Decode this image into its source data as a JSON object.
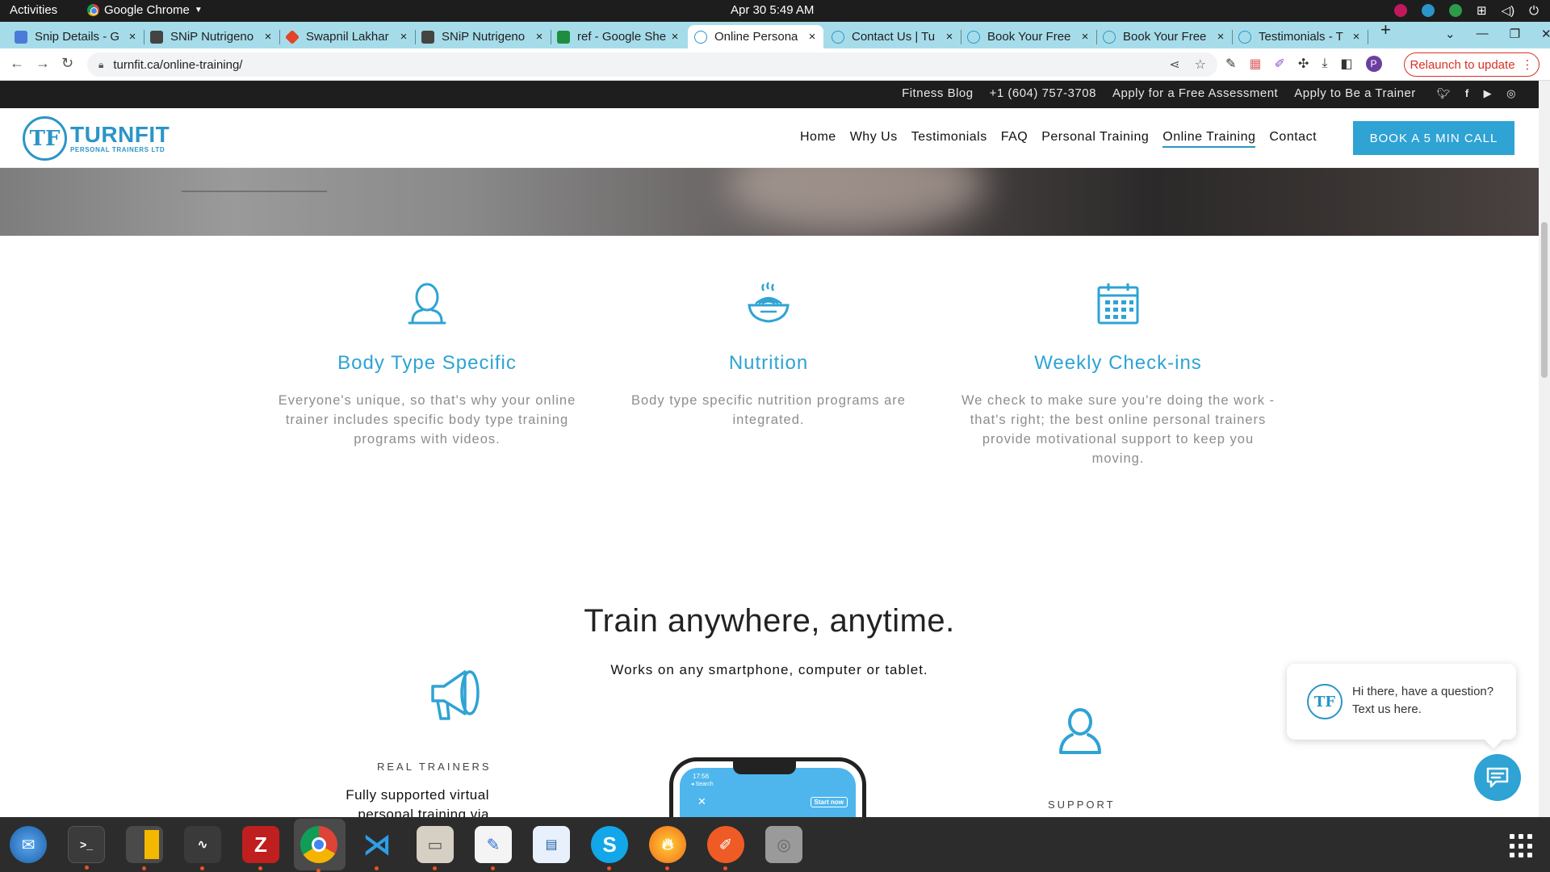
{
  "os_bar": {
    "activities": "Activities",
    "app_name": "Google Chrome",
    "clock": "Apr 30  5:49 AM"
  },
  "tabs": [
    {
      "label": "Snip Details - G",
      "favicon": "doc-icon"
    },
    {
      "label": "SNiP Nutrigeno",
      "favicon": "snip-icon"
    },
    {
      "label": "Swapnil Lakhar",
      "favicon": "gitlab-icon"
    },
    {
      "label": "SNiP Nutrigeno",
      "favicon": "snip-icon"
    },
    {
      "label": "ref - Google She",
      "favicon": "sheets-icon"
    },
    {
      "label": "Online Persona",
      "favicon": "turnfit-icon",
      "active": true
    },
    {
      "label": "Contact Us | Tu",
      "favicon": "turnfit-icon"
    },
    {
      "label": "Book Your Free",
      "favicon": "turnfit-icon"
    },
    {
      "label": "Book Your Free",
      "favicon": "turnfit-icon"
    },
    {
      "label": "Testimonials - T",
      "favicon": "turnfit-icon"
    }
  ],
  "toolbar": {
    "url": "turnfit.ca/online-training/",
    "relaunch_label": "Relaunch to update",
    "profile_initial": "P"
  },
  "utility_bar": {
    "links": [
      "Fitness Blog",
      "+1 (604) 757-3708",
      "Apply for a Free Assessment",
      "Apply to Be a Trainer"
    ],
    "social": [
      "twitter-icon",
      "facebook-icon",
      "youtube-icon",
      "instagram-icon"
    ]
  },
  "site": {
    "logo_mark": "TF",
    "brand": "TURNFIT",
    "brand_sub": "PERSONAL TRAINERS LTD",
    "nav": [
      "Home",
      "Why Us",
      "Testimonials",
      "FAQ",
      "Personal Training",
      "Online Training",
      "Contact"
    ],
    "nav_active": "Online Training",
    "cta": "BOOK A 5 MIN CALL"
  },
  "features": [
    {
      "icon": "person-icon",
      "title": "Body Type Specific",
      "desc": "Everyone's unique, so that's why your online trainer includes specific body type training programs with videos."
    },
    {
      "icon": "food-bowl-icon",
      "title": "Nutrition",
      "desc": "Body type specific nutrition programs are integrated."
    },
    {
      "icon": "calendar-icon",
      "title": "Weekly Check-ins",
      "desc": "We check to make sure you're doing the work - that's right; the best online personal trainers\nprovide motivational support to keep you moving."
    }
  ],
  "train_section": {
    "title": "Train anywhere, anytime.",
    "subtitle": "Works on any smartphone, computer or tablet.",
    "left_label": "REAL TRAINERS",
    "left_text": "Fully supported virtual personal training via",
    "right_label": "SUPPORT",
    "phone": {
      "time": "17:56",
      "search": "◂ Search",
      "start": "Start now"
    }
  },
  "chat": {
    "logo_mark": "TF",
    "text": "Hi there, have a question? Text us here."
  },
  "dock": [
    "thunderbird-icon",
    "terminal-icon",
    "calculator-icon",
    "system-monitor-icon",
    "filezilla-icon",
    "chrome-icon",
    "vscode-icon",
    "files-icon",
    "text-editor-icon",
    "libreoffice-writer-icon",
    "skype-icon",
    "burner-icon",
    "postman-icon",
    "disk-icon"
  ],
  "colors": {
    "accent": "#2ea3d4",
    "tabstrip": "#a6dcea",
    "relaunch": "#d93025"
  }
}
